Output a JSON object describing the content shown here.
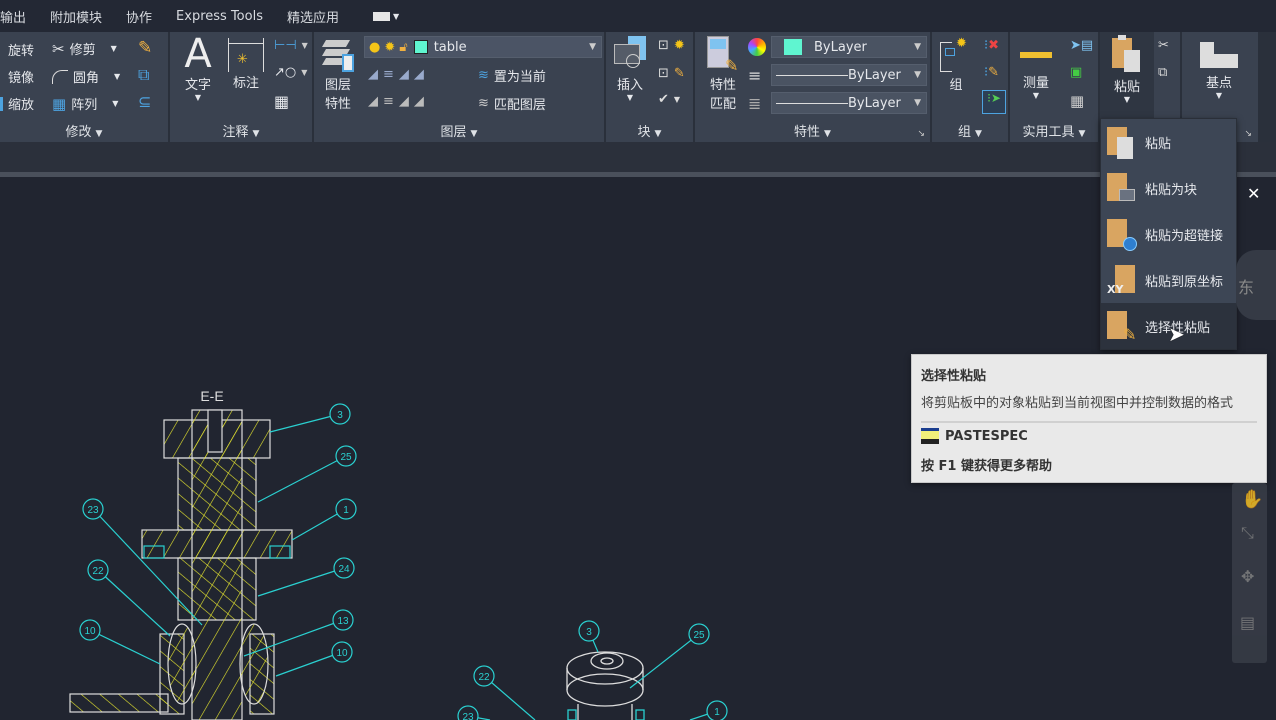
{
  "menubar": {
    "items": [
      "输出",
      "附加模块",
      "协作",
      "Express Tools",
      "精选应用"
    ],
    "extra_icon": "workspace-dropdown-icon"
  },
  "ribbon": {
    "modify": {
      "label": "修改",
      "items": [
        "旋转",
        "镜像",
        "缩放",
        "修剪",
        "圆角",
        "阵列"
      ]
    },
    "annotate": {
      "label": "注释",
      "text": "文字",
      "dimension": "标注"
    },
    "layers": {
      "label": "图层",
      "layer_props": "图层特性",
      "layer_props_lines": [
        "图层",
        "特性"
      ],
      "current_layer": "table",
      "layer_color": "#5ff5d0",
      "set_current": "置为当前",
      "match_layer": "匹配图层"
    },
    "block": {
      "label": "块",
      "insert": "插入"
    },
    "properties": {
      "label": "特性",
      "match": [
        "特性",
        "匹配"
      ],
      "color": "ByLayer",
      "color_swatch": "#5ff5d0",
      "linetype": "ByLayer",
      "lineweight": "ByLayer"
    },
    "groups": {
      "label": "组",
      "group": "组"
    },
    "utilities": {
      "label": "实用工具",
      "measure": "测量"
    },
    "clipboard": {
      "paste": "粘贴"
    },
    "view": {
      "basepoint": "基点"
    }
  },
  "paste_menu": {
    "items": [
      {
        "label": "粘贴",
        "icon": "paste-icon"
      },
      {
        "label": "粘贴为块",
        "icon": "paste-as-block-icon"
      },
      {
        "label": "粘贴为超链接",
        "icon": "paste-as-hyperlink-icon"
      },
      {
        "label": "粘贴到原坐标",
        "icon": "paste-to-original-coords-icon",
        "badge": "XY"
      },
      {
        "label": "选择性粘贴",
        "icon": "paste-special-icon",
        "highlighted": true
      }
    ]
  },
  "tooltip": {
    "title": "选择性粘贴",
    "description": "将剪贴板中的对象粘贴到当前视图中并控制数据的格式",
    "command": "PASTESPEC",
    "help": "按 F1 键获得更多帮助"
  },
  "viewcube": {
    "east": "东"
  },
  "drawing": {
    "section_label": "E-E",
    "balloons_section": [
      "3",
      "25",
      "1",
      "24",
      "13",
      "10",
      "23",
      "22",
      "10"
    ],
    "balloons_iso": [
      "3",
      "25",
      "22",
      "23",
      "1"
    ]
  },
  "colors": {
    "hatch": "#e6e62e",
    "leader": "#2ad0d0",
    "background": "#212530",
    "ribbon": "#3a4250"
  }
}
